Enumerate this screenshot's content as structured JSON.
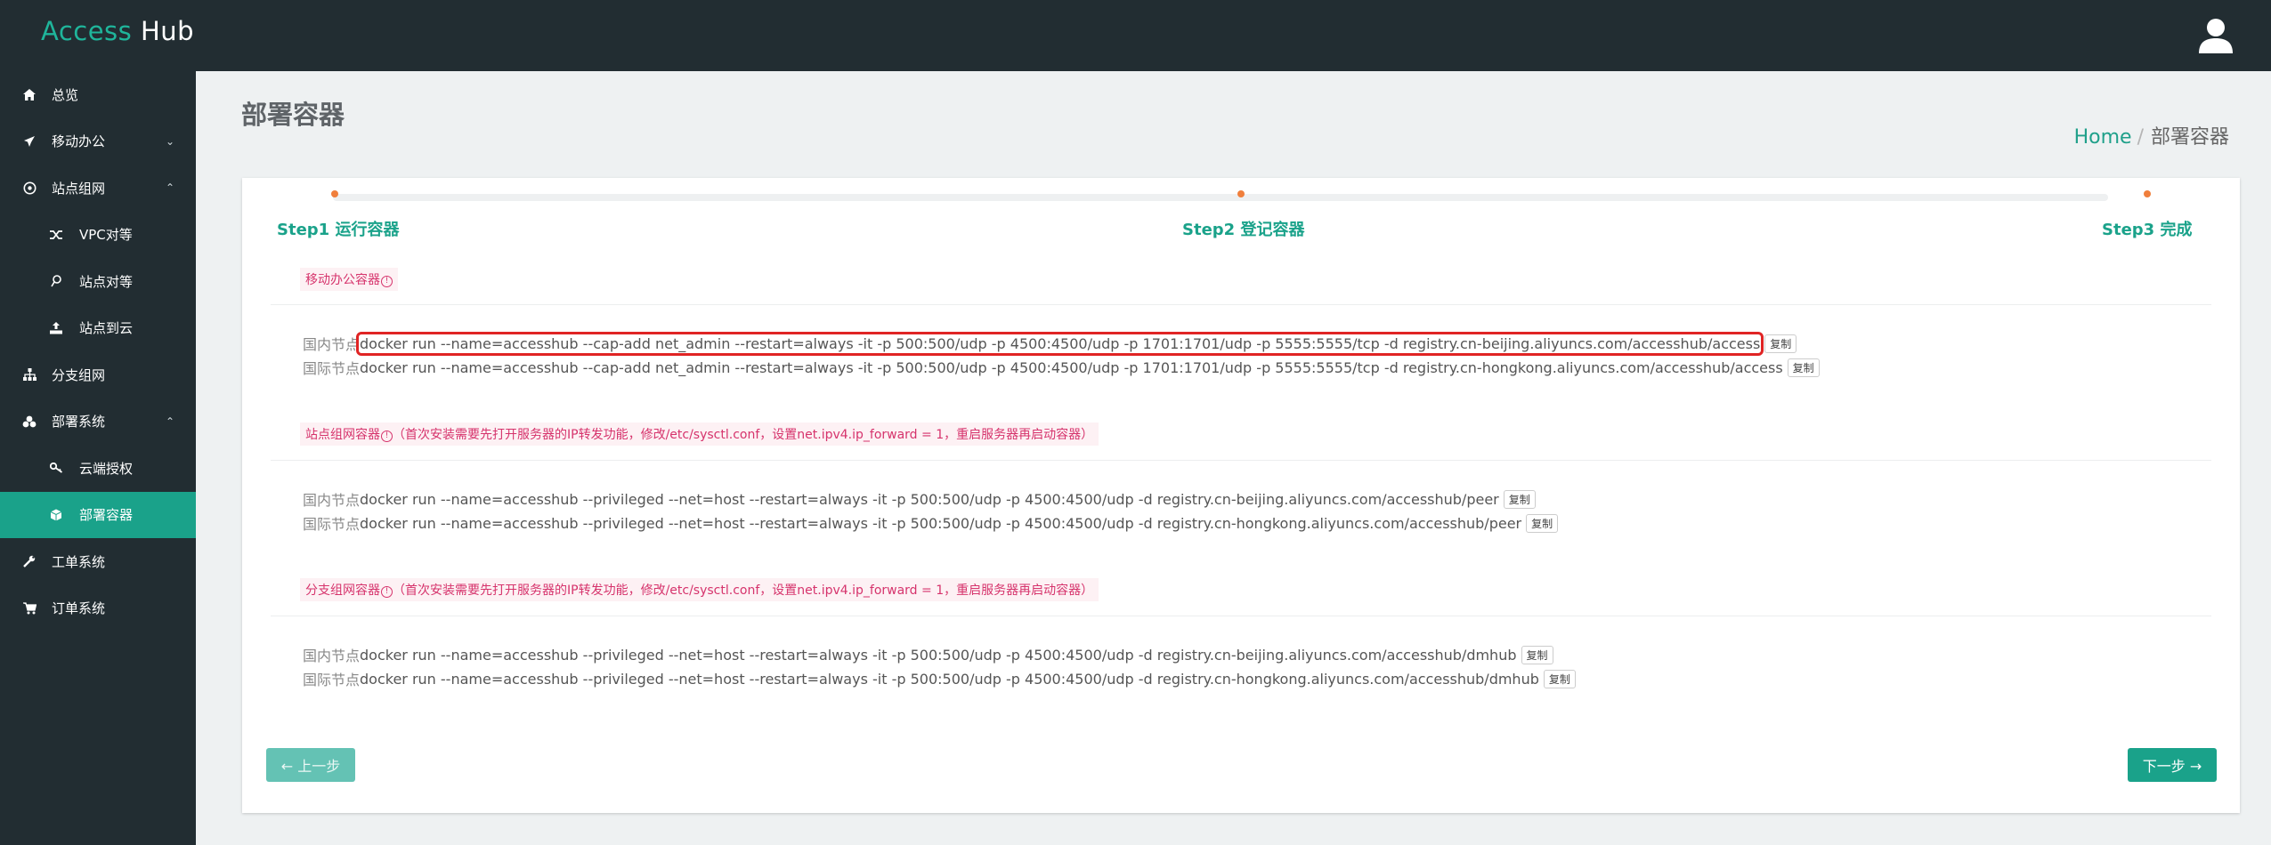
{
  "app": {
    "title_part1": "Access",
    "title_part2": "Hub"
  },
  "header": {
    "user_icon": "user-icon"
  },
  "sidebar": {
    "items": [
      {
        "label": "总览",
        "icon": "home-icon"
      },
      {
        "label": "移动办公",
        "icon": "plane-icon",
        "caret": "⌄"
      },
      {
        "label": "站点组网",
        "icon": "network-icon",
        "caret": "⌃"
      },
      {
        "label": "VPC对等",
        "icon": "shuffle-icon"
      },
      {
        "label": "站点对等",
        "icon": "pin-icon"
      },
      {
        "label": "站点到云",
        "icon": "upload-icon"
      },
      {
        "label": "分支组网",
        "icon": "sitemap-icon"
      },
      {
        "label": "部署系统",
        "icon": "cubes-icon",
        "caret": "⌃"
      },
      {
        "label": "云端授权",
        "icon": "key-icon"
      },
      {
        "label": "部署容器",
        "icon": "cube-icon"
      },
      {
        "label": "工单系统",
        "icon": "wrench-icon"
      },
      {
        "label": "订单系统",
        "icon": "cart-icon"
      }
    ],
    "active_index": 9
  },
  "page": {
    "title": "部署容器",
    "breadcrumb": {
      "home": "Home",
      "sep": "/",
      "current": "部署容器"
    }
  },
  "steps": [
    {
      "label": "Step1 运行容器"
    },
    {
      "label": "Step2 登记容器"
    },
    {
      "label": "Step3 完成"
    }
  ],
  "sections": [
    {
      "tag": "移动办公容器",
      "note": "",
      "lines": [
        {
          "node": "国内节点",
          "cmd": "docker run --name=accesshub --cap-add net_admin --restart=always -it -p 500:500/udp -p 4500:4500/udp -p 1701:1701/udp -p 5555:5555/tcp -d registry.cn-beijing.aliyuncs.com/accesshub/access",
          "copy": "复制"
        },
        {
          "node": "国际节点",
          "cmd": "docker run --name=accesshub --cap-add net_admin --restart=always -it -p 500:500/udp -p 4500:4500/udp -p 1701:1701/udp -p 5555:5555/tcp -d registry.cn-hongkong.aliyuncs.com/accesshub/access",
          "copy": "复制"
        }
      ]
    },
    {
      "tag": "站点组网容器",
      "note": "（首次安装需要先打开服务器的IP转发功能，修改/etc/sysctl.conf，设置net.ipv4.ip_forward = 1，重启服务器再启动容器）",
      "lines": [
        {
          "node": "国内节点",
          "cmd": "docker run --name=accesshub --privileged --net=host --restart=always -it -p 500:500/udp -p 4500:4500/udp -d registry.cn-beijing.aliyuncs.com/accesshub/peer",
          "copy": "复制"
        },
        {
          "node": "国际节点",
          "cmd": "docker run --name=accesshub --privileged --net=host --restart=always -it -p 500:500/udp -p 4500:4500/udp -d registry.cn-hongkong.aliyuncs.com/accesshub/peer",
          "copy": "复制"
        }
      ]
    },
    {
      "tag": "分支组网容器",
      "note": "（首次安装需要先打开服务器的IP转发功能，修改/etc/sysctl.conf，设置net.ipv4.ip_forward = 1，重启服务器再启动容器）",
      "lines": [
        {
          "node": "国内节点",
          "cmd": "docker run --name=accesshub --privileged --net=host --restart=always -it -p 500:500/udp -p 4500:4500/udp -d registry.cn-beijing.aliyuncs.com/accesshub/dmhub",
          "copy": "复制"
        },
        {
          "node": "国际节点",
          "cmd": "docker run --name=accesshub --privileged --net=host --restart=always -it -p 500:500/udp -p 4500:4500/udp -d registry.cn-hongkong.aliyuncs.com/accesshub/dmhub",
          "copy": "复制"
        }
      ]
    }
  ],
  "buttons": {
    "prev": "← 上一步",
    "next": "下一步 →"
  },
  "colors": {
    "accent": "#1aa28a",
    "sidebar_bg": "#222d32",
    "highlight": "#e02424",
    "tag": "#d6336c",
    "step_dot": "#f07f3c"
  }
}
